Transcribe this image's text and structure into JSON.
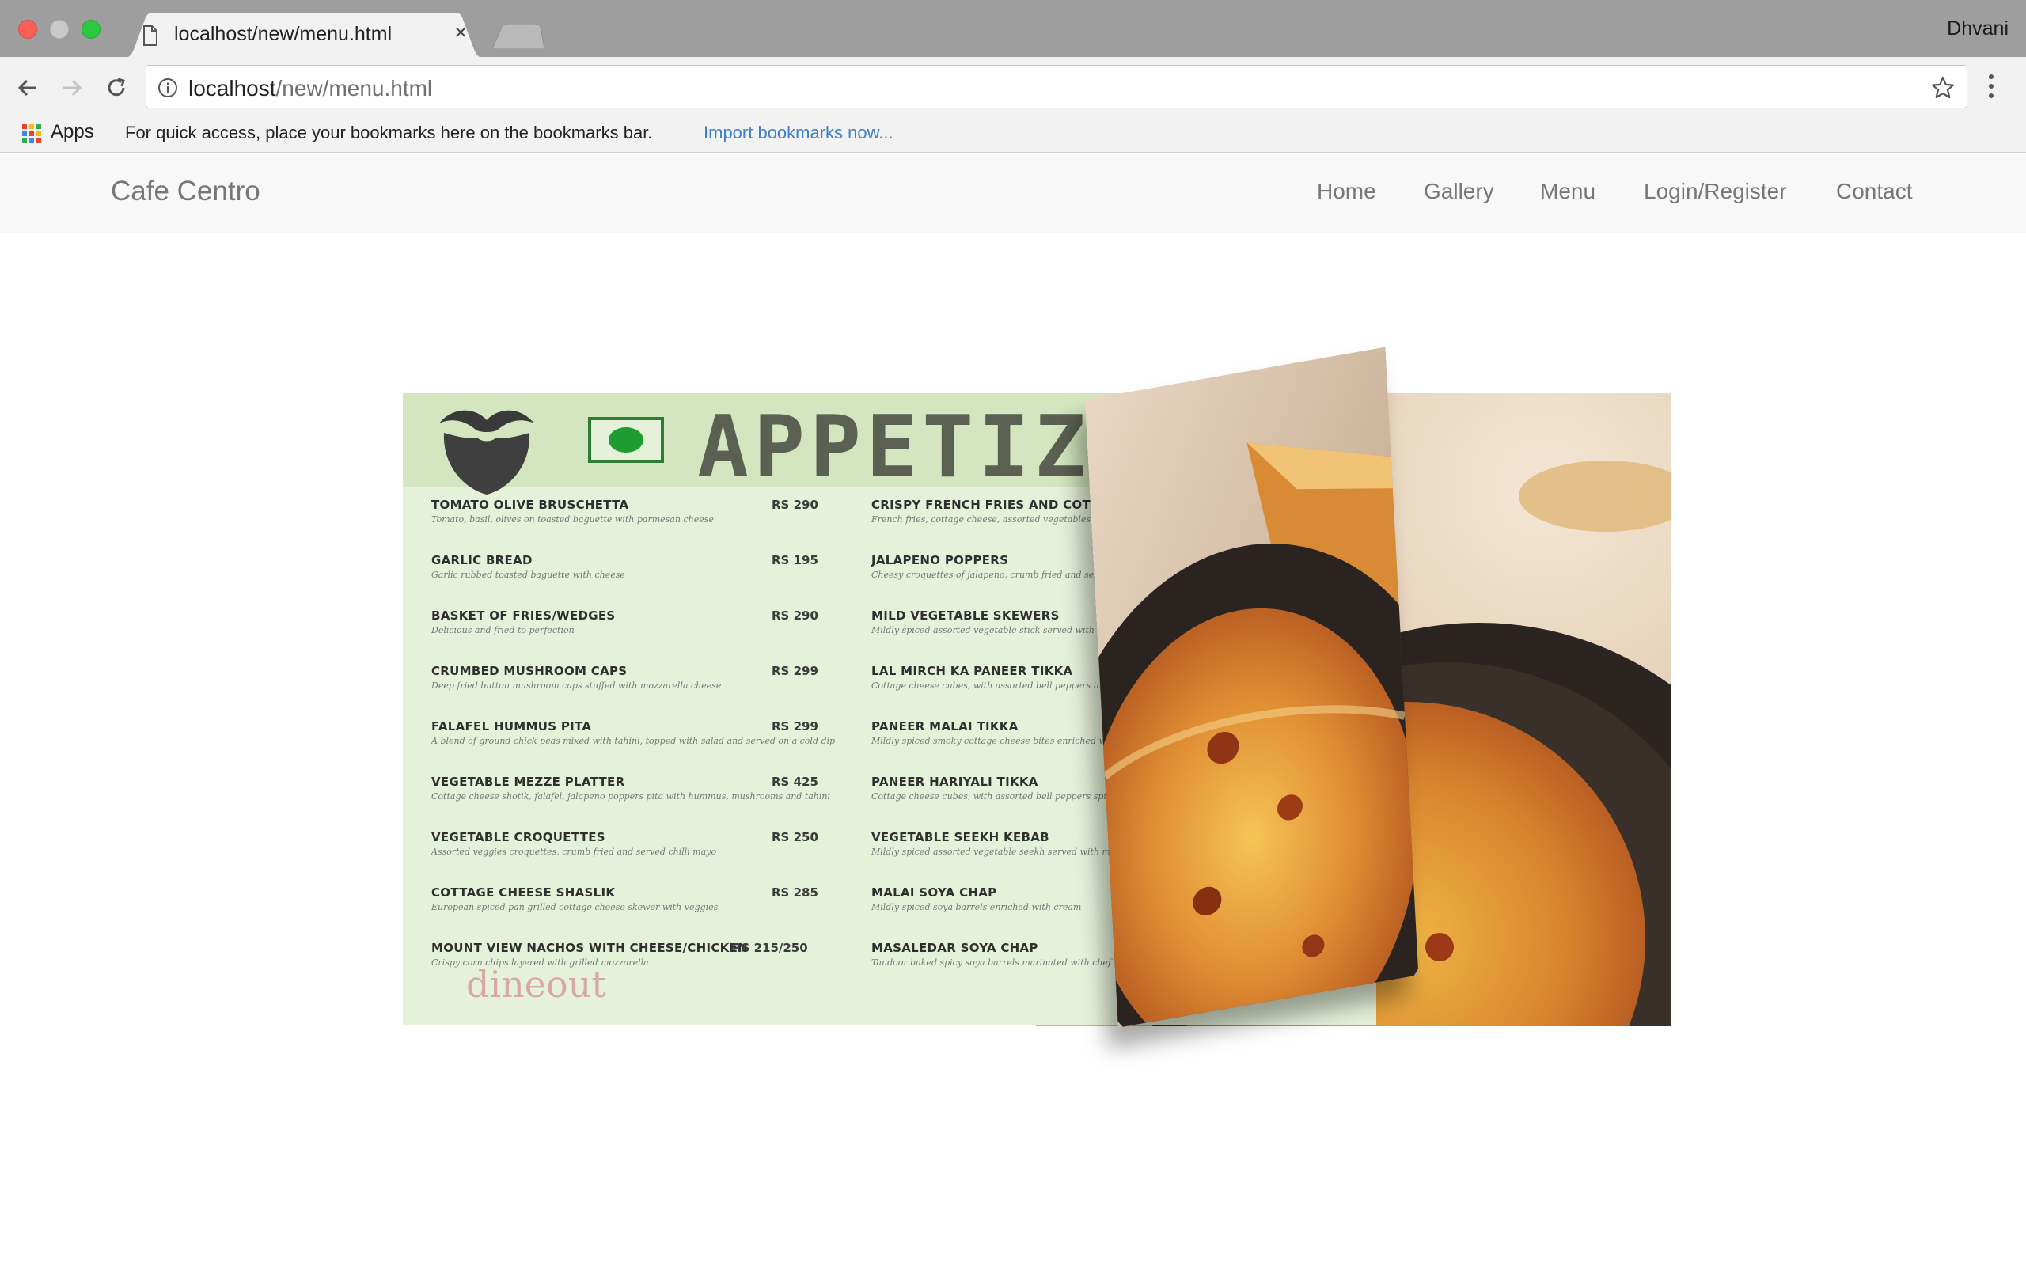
{
  "browser": {
    "tab_title": "localhost/new/menu.html",
    "tab_close": "×",
    "profile": "Dhvani",
    "url_host": "localhost",
    "url_path": "/new/menu.html",
    "bookmarks_apps": "Apps",
    "bookmarks_message": "For quick access, place your bookmarks here on the bookmarks bar.",
    "bookmarks_import": "Import bookmarks now..."
  },
  "site": {
    "brand": "Cafe Centro",
    "nav": [
      "Home",
      "Gallery",
      "Menu",
      "Login/Register",
      "Contact"
    ]
  },
  "menu_image": {
    "title": "APPETIZ",
    "left_items": [
      {
        "name": "TOMATO OLIVE BRUSCHETTA",
        "price": "RS 290"
      },
      {
        "name": "GARLIC BREAD",
        "price": "RS 195"
      },
      {
        "name": "BASKET OF FRIES/WEDGES",
        "price": "RS 290"
      },
      {
        "name": "CRUMBED MUSHROOM CAPS",
        "price": "RS 299"
      },
      {
        "name": "FALAFEL HUMMUS PITA",
        "price": "RS 299"
      },
      {
        "name": "VEGETABLE MEZZE PLATTER",
        "price": "RS 425"
      },
      {
        "name": "VEGETABLE CROQUETTES",
        "price": "RS 250"
      },
      {
        "name": "COTTAGE CHEESE SHASLIK",
        "price": "RS 285"
      },
      {
        "name": "MOUNT VIEW NACHOS WITH CHEESE/CHICKEN",
        "price": "RS 215/250"
      }
    ],
    "right_items": [
      {
        "name": "CRISPY FRENCH FRIES AND COTTAGE CHEESE WRAP"
      },
      {
        "name": "JALAPENO POPPERS"
      },
      {
        "name": "MILD VEGETABLE SKEWERS"
      },
      {
        "name": "LAL MIRCH KA PANEER TIKKA"
      },
      {
        "name": "PANEER MALAI TIKKA"
      },
      {
        "name": "PANEER HARIYALI TIKKA"
      },
      {
        "name": "VEGETABLE SEEKH KEBAB"
      },
      {
        "name": "MALAI SOYA CHAP"
      },
      {
        "name": "MASALEDAR SOYA CHAP"
      }
    ],
    "watermark": "dineout"
  },
  "colors": {
    "chrome_titlebar": "#9e9e9e",
    "chrome_toolbar": "#f2f2f2",
    "link_blue": "#3c80c8",
    "navbar_bg": "#f8f8f8",
    "nav_text": "#777777",
    "menu_bg": "#e6f1d9"
  },
  "icons": {
    "tab_favicon": "page-icon",
    "back": "arrow-left-icon",
    "forward": "arrow-right-icon",
    "reload": "reload-icon",
    "info": "info-icon",
    "bookmark": "star-icon",
    "menu": "kebab-menu-icon",
    "apps": "apps-grid-icon"
  }
}
